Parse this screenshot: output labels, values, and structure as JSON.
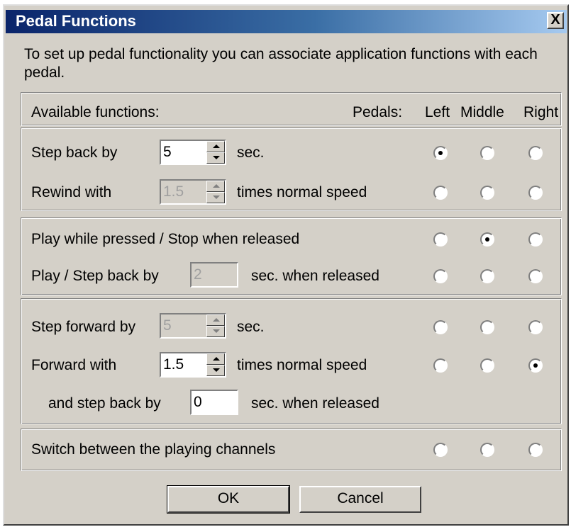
{
  "dialog": {
    "title": "Pedal Functions",
    "close_label": "X",
    "intro": "To set up pedal functionality you can associate application functions with each pedal."
  },
  "header": {
    "available_functions": "Available functions:",
    "pedals": "Pedals:",
    "left": "Left",
    "middle": "Middle",
    "right": "Right"
  },
  "rows": {
    "step_back": {
      "label": "Step back by",
      "value": "5",
      "unit": "sec.",
      "selected": "left"
    },
    "rewind": {
      "label": "Rewind with",
      "value": "1.5",
      "unit": "times normal speed",
      "selected": "none"
    },
    "play_pressed": {
      "label": "Play while pressed / Stop when released",
      "selected": "middle"
    },
    "play_step": {
      "label": "Play / Step back by",
      "value": "2",
      "unit": "sec. when released",
      "selected": "none"
    },
    "step_forward": {
      "label": "Step forward by",
      "value": "5",
      "unit": "sec.",
      "selected": "none"
    },
    "forward": {
      "label": "Forward with",
      "value": "1.5",
      "unit": "times normal speed",
      "selected": "right"
    },
    "and_step_back": {
      "label": "and step back by",
      "value": "0",
      "unit": "sec. when released"
    },
    "switch_channels": {
      "label": "Switch between the playing channels",
      "selected": "none"
    }
  },
  "buttons": {
    "ok": "OK",
    "cancel": "Cancel"
  }
}
